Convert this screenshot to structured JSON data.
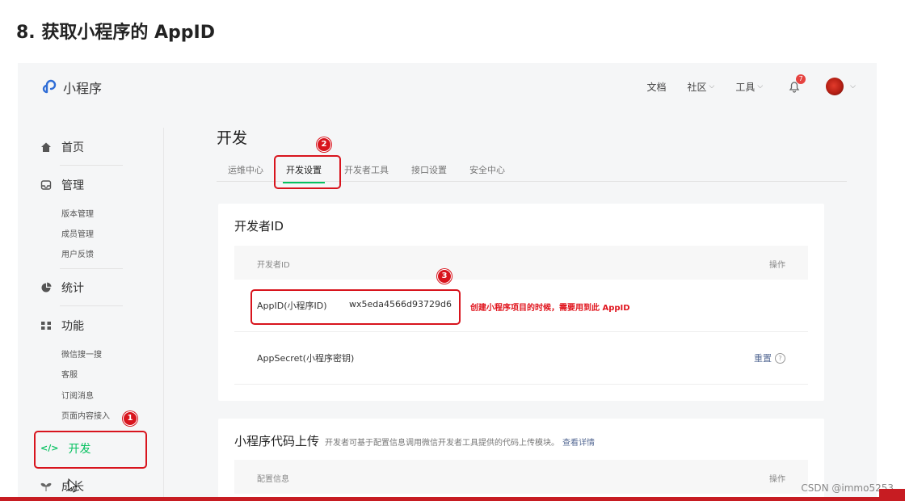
{
  "slide": {
    "title": "8. 获取小程序的 AppID"
  },
  "header": {
    "logo_text": "小程序",
    "nav": [
      {
        "label": "文档"
      },
      {
        "label": "社区"
      },
      {
        "label": "工具"
      }
    ],
    "notification_count": "7"
  },
  "sidebar": {
    "sections": [
      {
        "label": "首页",
        "icon": "home-icon"
      },
      {
        "label": "管理",
        "icon": "inbox-icon",
        "items": [
          "版本管理",
          "成员管理",
          "用户反馈"
        ]
      },
      {
        "label": "统计",
        "icon": "pie-chart-icon"
      },
      {
        "label": "功能",
        "icon": "grid-icon",
        "items": [
          "微信搜一搜",
          "客服",
          "订阅消息",
          "页面内容接入"
        ]
      },
      {
        "label": "开发",
        "icon": "code-icon"
      },
      {
        "label": "成长",
        "icon": "sprout-icon"
      }
    ]
  },
  "main": {
    "page_title": "开发",
    "tabs": [
      {
        "label": "运维中心"
      },
      {
        "label": "开发设置"
      },
      {
        "label": "开发者工具"
      },
      {
        "label": "接口设置"
      },
      {
        "label": "安全中心"
      }
    ],
    "developer_id_card": {
      "title": "开发者ID",
      "col_name": "开发者ID",
      "col_action": "操作",
      "appid_label": "AppID(小程序ID)",
      "appid_value": "wx5eda4566d93729d6",
      "appsecret_label": "AppSecret(小程序密钥)",
      "reset_label": "重置",
      "help_glyph": "?"
    },
    "upload_card": {
      "title": "小程序代码上传",
      "description": "开发者可基于配置信息调用微信开发者工具提供的代码上传模块。",
      "detail_link": "查看详情",
      "col_name": "配置信息",
      "col_action": "操作"
    }
  },
  "annotations": {
    "markers": [
      "1",
      "2",
      "3"
    ],
    "note": "创建小程序项目的时候，需要用到此 AppID"
  },
  "watermark": "CSDN @immo5253",
  "colors": {
    "accent_green": "#07c160",
    "annotation_red": "#d8141d",
    "link_blue": "#576b95"
  }
}
